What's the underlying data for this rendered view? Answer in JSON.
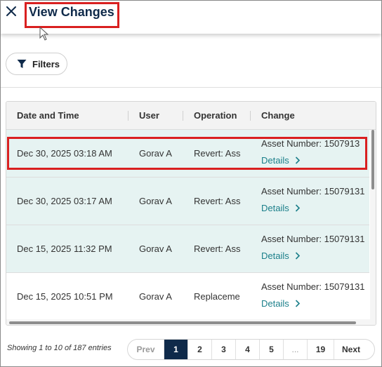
{
  "header": {
    "title": "View Changes",
    "close_icon": "close-icon"
  },
  "toolbar": {
    "filters_label": "Filters",
    "filters_icon": "filter-icon"
  },
  "table": {
    "columns": [
      "Date and Time",
      "User",
      "Operation",
      "Change"
    ],
    "rows": [
      {
        "date": "Dec 30, 2025 03:18 AM",
        "user": "Gorav A",
        "operation": "Revert: Ass",
        "change": "Asset Number: 1507913",
        "details": "Details"
      },
      {
        "date": "Dec 30, 2025 03:17 AM",
        "user": "Gorav A",
        "operation": "Revert: Ass",
        "change": "Asset Number: 15079131",
        "details": "Details"
      },
      {
        "date": "Dec 15, 2025 11:32 PM",
        "user": "Gorav A",
        "operation": "Revert: Ass",
        "change": "Asset Number: 15079131",
        "details": "Details"
      },
      {
        "date": "Dec 15, 2025 10:51 PM",
        "user": "Gorav A",
        "operation": "Replaceme",
        "change": "Asset Number: 15079131",
        "details": "Details"
      }
    ]
  },
  "footer": {
    "showing": "Showing 1 to 10 of 187 entries",
    "pagination": {
      "prev": "Prev",
      "pages": [
        "1",
        "2",
        "3",
        "4",
        "5"
      ],
      "ellipsis": "...",
      "last": "19",
      "next": "Next",
      "current": "1"
    }
  },
  "colors": {
    "accent": "#0f2a4a",
    "link": "#1b7f8a",
    "row_alt": "#e6f3f2",
    "highlight": "#d92020"
  }
}
